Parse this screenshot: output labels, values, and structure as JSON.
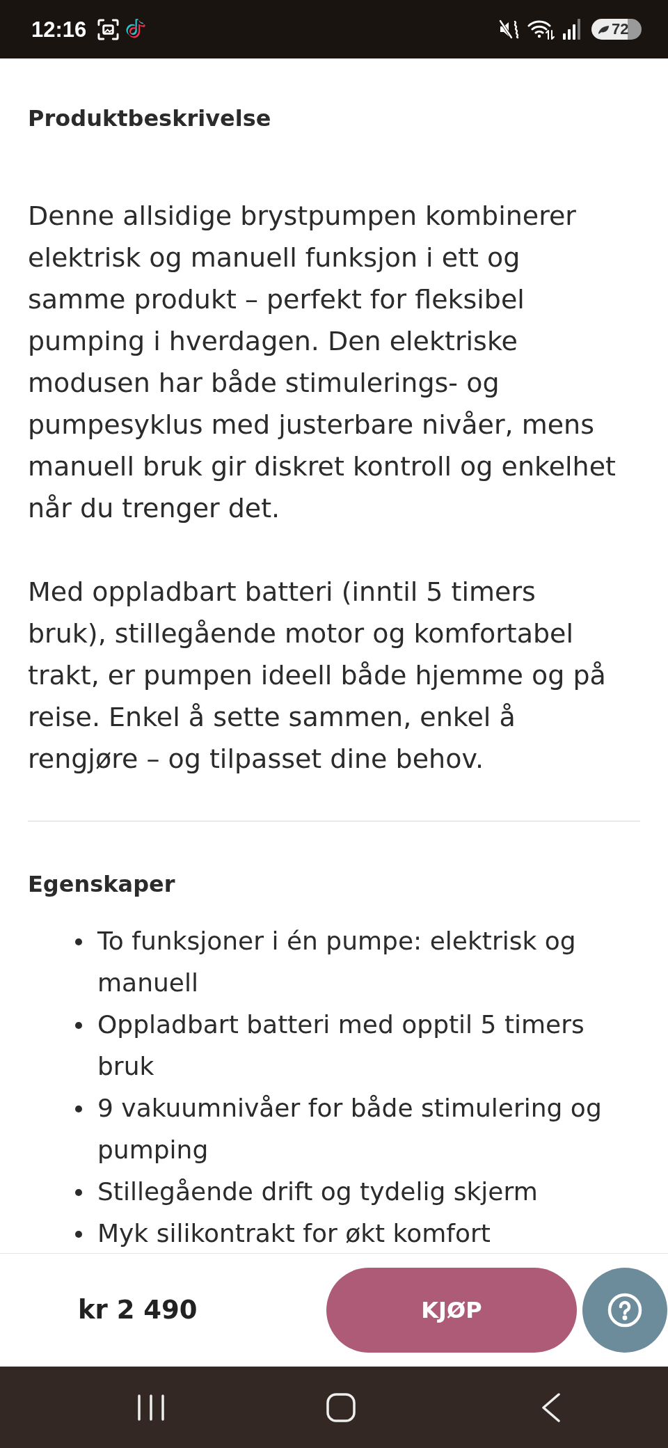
{
  "status_bar": {
    "time": "12:16",
    "battery": "72"
  },
  "description": {
    "title": "Produktbeskrivelse",
    "paragraphs": [
      "Denne allsidige brystpumpen kombinerer elektrisk og manuell funksjon i ett og samme produkt – perfekt for fleksibel pumping i hverdagen. Den elektriske modusen har både stimulerings- og pumpesyklus med justerbare nivåer, mens manuell bruk gir diskret kontroll og enkelhet når du trenger det.",
      "Med oppladbart batteri (inntil 5 timers bruk), stillegående motor og komfortabel trakt, er pumpen ideell både hjemme og på reise. Enkel å sette sammen, enkel å rengjøre – og tilpasset dine behov."
    ]
  },
  "features": {
    "title": "Egenskaper",
    "items": [
      "To funksjoner i én pumpe: elektrisk og manuell",
      "Oppladbart batteri med opptil 5 timers bruk",
      "9 vakuumnivåer for både stimulering og pumping",
      "Stillegående drift og tydelig skjerm",
      "Myk silikontrakt for økt komfort"
    ]
  },
  "purchase_bar": {
    "price": "kr 2 490",
    "buy_button": "KJØP"
  }
}
